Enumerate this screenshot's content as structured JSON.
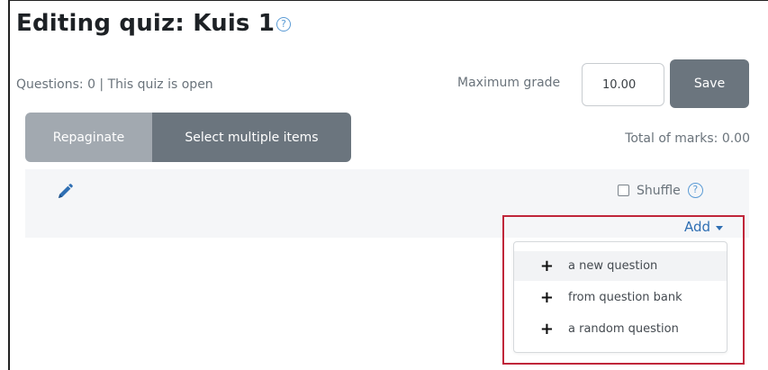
{
  "page": {
    "title": "Editing quiz: Kuis 1",
    "help_glyph": "?"
  },
  "status_text": "Questions: 0 | This quiz is open",
  "grade": {
    "label": "Maximum grade",
    "value": "10.00",
    "save_label": "Save"
  },
  "toolbar": {
    "repaginate_label": "Repaginate",
    "select_multiple_label": "Select multiple items"
  },
  "total_marks_text": "Total of marks: 0.00",
  "section": {
    "edit_icon": "pencil-icon",
    "shuffle_label": "Shuffle",
    "shuffle_checked": false,
    "help_glyph": "?"
  },
  "add_menu": {
    "toggle_label": "Add",
    "items": [
      {
        "icon": "plus-icon",
        "glyph": "+",
        "label": "a new question"
      },
      {
        "icon": "plus-icon",
        "glyph": "+",
        "label": "from question bank"
      },
      {
        "icon": "plus-icon",
        "glyph": "+",
        "label": "a random question"
      }
    ]
  },
  "colors": {
    "highlight_border": "#c0263a",
    "link": "#2f6fb3",
    "button_dark": "#6b757e",
    "button_light": "#a2a9b0",
    "help_icon": "#5b9bd5"
  }
}
